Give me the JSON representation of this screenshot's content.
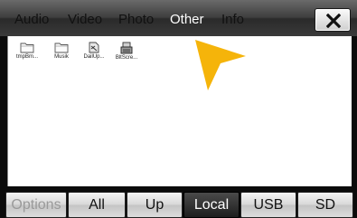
{
  "tabs": [
    {
      "label": "Audio"
    },
    {
      "label": "Video"
    },
    {
      "label": "Photo"
    },
    {
      "label": "Other"
    },
    {
      "label": "Info"
    }
  ],
  "active_tab": "Other",
  "files": [
    {
      "name": "tmpBm...",
      "icon": "folder-icon"
    },
    {
      "name": "Musik",
      "icon": "folder-icon"
    },
    {
      "name": "DailUp...",
      "icon": "file-icon"
    },
    {
      "name": "BltScre...",
      "icon": "device-icon"
    }
  ],
  "buttons": {
    "options": "Options",
    "all": "All",
    "up": "Up",
    "local": "Local",
    "usb": "USB",
    "sd": "SD"
  },
  "colors": {
    "accent_arrow": "#f5b40a",
    "active_button": "#2a2a2a"
  }
}
